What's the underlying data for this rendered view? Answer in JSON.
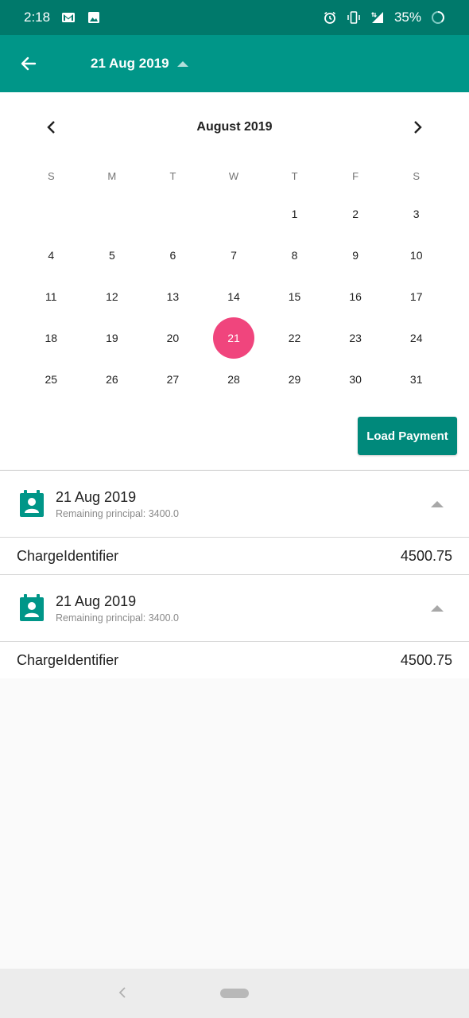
{
  "status_bar": {
    "time": "2:18",
    "battery": "35%"
  },
  "toolbar": {
    "title": "21 Aug 2019"
  },
  "calendar": {
    "month_title": "August 2019",
    "weekdays": [
      "S",
      "M",
      "T",
      "W",
      "T",
      "F",
      "S"
    ],
    "weeks": [
      [
        "",
        "",
        "",
        "",
        "1",
        "2",
        "3"
      ],
      [
        "4",
        "5",
        "6",
        "7",
        "8",
        "9",
        "10"
      ],
      [
        "11",
        "12",
        "13",
        "14",
        "15",
        "16",
        "17"
      ],
      [
        "18",
        "19",
        "20",
        "21",
        "22",
        "23",
        "24"
      ],
      [
        "25",
        "26",
        "27",
        "28",
        "29",
        "30",
        "31"
      ]
    ],
    "selected_day": "21",
    "selected_color": "#f0457d"
  },
  "load_button": {
    "label": "Load Payment"
  },
  "payments": [
    {
      "date": "21 Aug 2019",
      "remaining": "Remaining principal: 3400.0",
      "charge_label": "ChargeIdentifier",
      "charge_value": "4500.75"
    },
    {
      "date": "21 Aug 2019",
      "remaining": "Remaining principal: 3400.0",
      "charge_label": "ChargeIdentifier",
      "charge_value": "4500.75"
    }
  ],
  "colors": {
    "primary": "#009688",
    "primary_dark": "#00796b",
    "accent": "#f0457d"
  }
}
